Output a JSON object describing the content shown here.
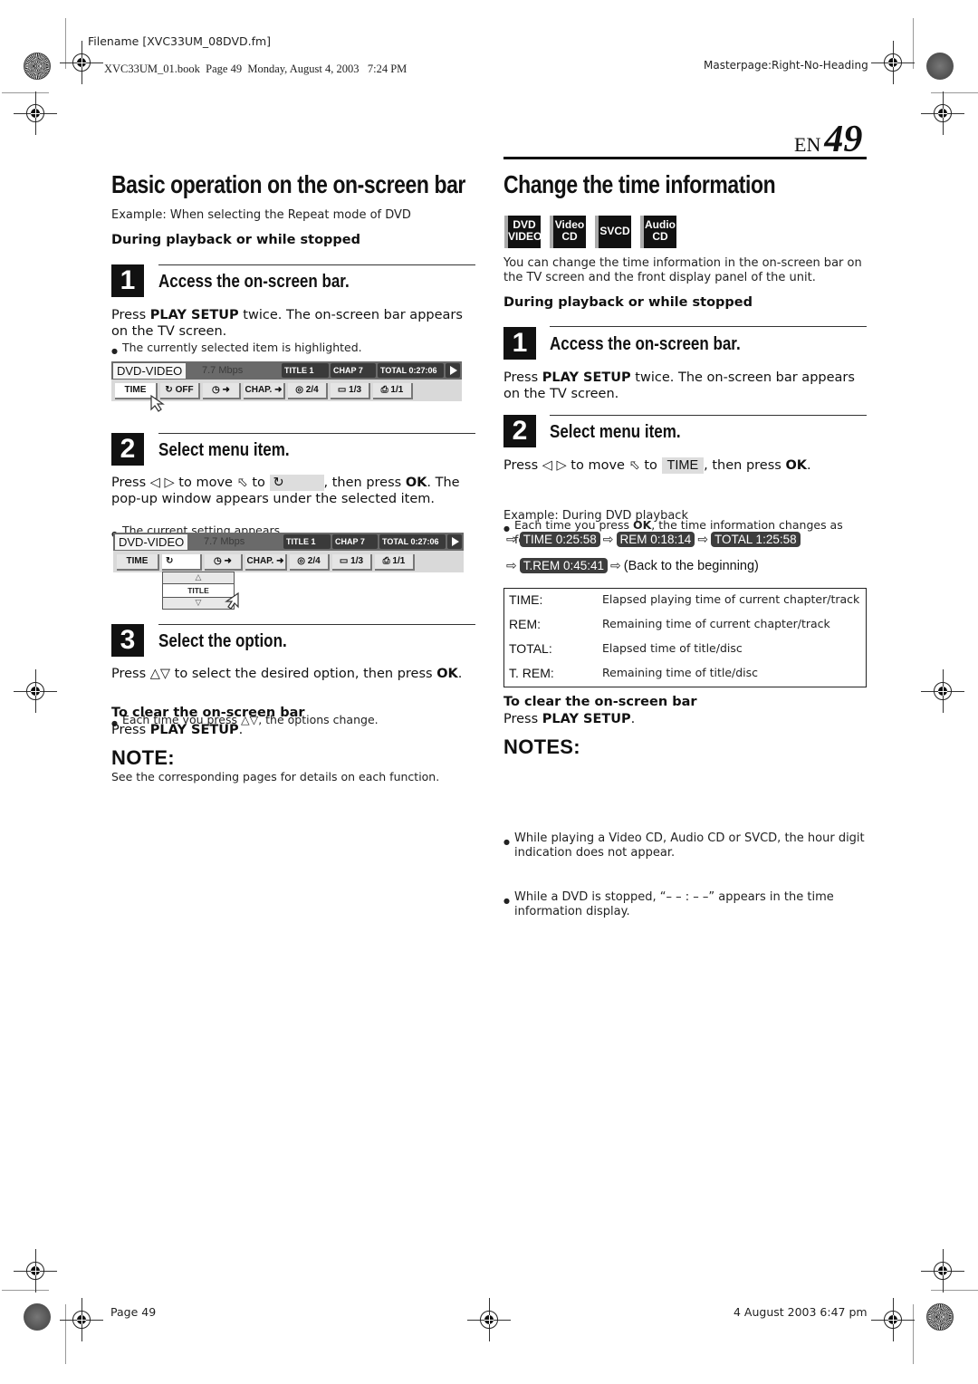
{
  "print_meta": {
    "filename": "Filename [XVC33UM_08DVD.fm]",
    "book_line": "XVC33UM_01.book  Page 49  Monday, August 4, 2003   7:24 PM",
    "masterpage": "Masterpage:Right-No-Heading",
    "footer_page": "Page 49",
    "footer_date": "4 August 2003 6:47 pm"
  },
  "page_number": {
    "prefix": "EN",
    "number": "49"
  },
  "left": {
    "title": "Basic operation on the on-screen bar",
    "example": "Example: When selecting the Repeat mode of DVD",
    "condition": "During playback or while stopped",
    "steps": [
      {
        "num": "1",
        "title": "Access the on-screen bar.",
        "text_pre": "Press ",
        "text_bold": "PLAY SETUP",
        "text_post": " twice. The on-screen bar appears on the TV screen.",
        "bullet": "The currently selected item is highlighted."
      },
      {
        "num": "2",
        "title": "Select menu item.",
        "text_a": "Press ◁ ▷ to move ⬁ to ",
        "text_b": ", then press ",
        "text_bold": "OK",
        "text_c": ". The pop-up window appears under the selected item.",
        "bullet": "The current setting appears."
      },
      {
        "num": "3",
        "title": "Select the option.",
        "text_a": "Press △▽ to select the desired option, then press ",
        "text_bold": "OK",
        "text_c": ".",
        "bullet": "Each time you press △▽, the options change."
      }
    ],
    "clear_head": "To clear the on-screen bar",
    "clear_pre": "Press ",
    "clear_bold": "PLAY SETUP",
    "clear_post": ".",
    "note_head": "NOTE:",
    "note_text": "See the corresponding pages for details on each function."
  },
  "osd_bar_1": {
    "format": "DVD-VIDEO",
    "bitrate": "7.7 Mbps",
    "title_label": "TITLE   1",
    "chap_label": "CHAP    7",
    "total_label": "TOTAL  0:27:06",
    "cells": [
      "TIME",
      "↻ OFF",
      "◷ ➜",
      "CHAP. ➜",
      "◎ 2/4",
      "▭ 1/3",
      "⎙ 1/1"
    ]
  },
  "osd_bar_2": {
    "format": "DVD-VIDEO",
    "bitrate": "7.7 Mbps",
    "title_label": "TITLE   1",
    "chap_label": "CHAP    7",
    "total_label": "TOTAL  0:27:06",
    "cells": [
      "TIME",
      "↻",
      "◷ ➜",
      "CHAP. ➜",
      "◎ 2/4",
      "▭ 1/3",
      "⎙ 1/1"
    ],
    "popup": {
      "up": "△",
      "value": "TITLE",
      "down": "▽"
    }
  },
  "repeat_chip": "↻",
  "right": {
    "title": "Change the time information",
    "badges": [
      {
        "line1": "DVD",
        "line2": "VIDEO"
      },
      {
        "line1": "Video",
        "line2": "CD"
      },
      {
        "line1": "SVCD",
        "line2": ""
      },
      {
        "line1": "Audio",
        "line2": "CD"
      }
    ],
    "intro": "You can change the time information in the on-screen bar on the TV screen and the front display panel of the unit.",
    "condition": "During playback or while stopped",
    "steps": [
      {
        "num": "1",
        "title": "Access the on-screen bar.",
        "text_pre": "Press ",
        "text_bold": "PLAY SETUP",
        "text_post": " twice. The on-screen bar appears on the TV screen."
      },
      {
        "num": "2",
        "title": "Select menu item.",
        "text_a": "Press ◁ ▷ to move ⬁ to ",
        "chip": "TIME",
        "text_b": ", then press ",
        "text_bold": "OK",
        "text_c": ".",
        "bullet_pre": "Each time you press ",
        "bullet_bold": "OK",
        "bullet_post": ", the time information changes as follows;"
      }
    ],
    "example": "Example: During DVD playback",
    "sequence": [
      "TIME  0:25:58",
      "REM  0:18:14",
      "TOTAL  1:25:58",
      "T.REM  0:45:41"
    ],
    "sequence_end": "(Back to the beginning)",
    "arrow": "⇨",
    "definitions": [
      {
        "term": "TIME:",
        "desc": "Elapsed playing time of current chapter/track"
      },
      {
        "term": "REM:",
        "desc": "Remaining time of current chapter/track"
      },
      {
        "term": "TOTAL:",
        "desc": "Elapsed time of title/disc"
      },
      {
        "term": "T. REM:",
        "desc": "Remaining time of title/disc"
      }
    ],
    "clear_head": "To clear the on-screen bar",
    "clear_pre": "Press ",
    "clear_bold": "PLAY SETUP",
    "clear_post": ".",
    "notes_head": "NOTES:",
    "notes": [
      "While playing a Video CD, Audio CD or SVCD, the hour digit indication does not appear.",
      "While a DVD is stopped, “– – : – –” appears in the time information display."
    ]
  }
}
